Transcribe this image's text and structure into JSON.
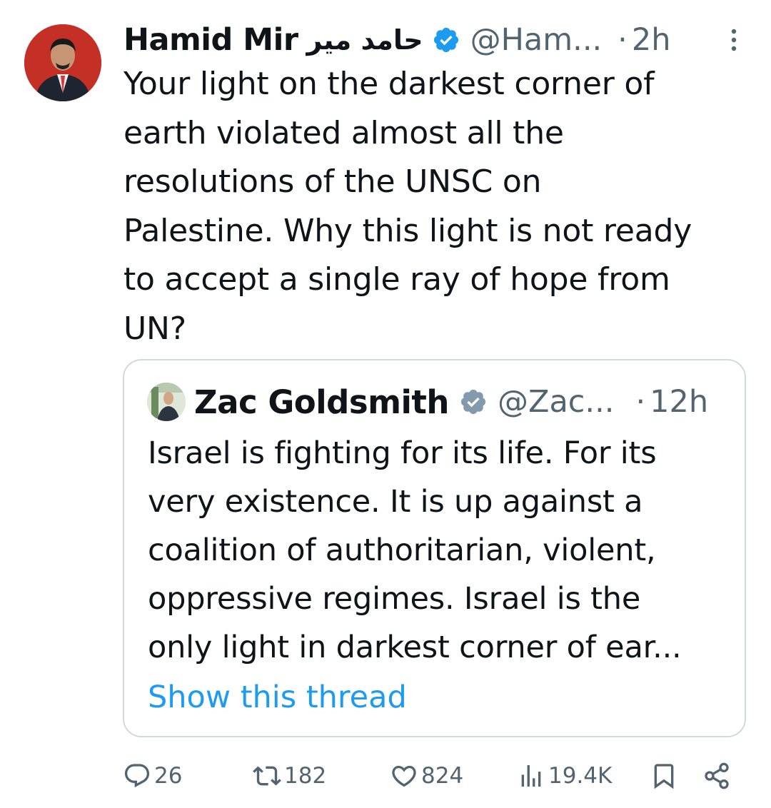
{
  "tweet": {
    "author_name": "Hamid Mir",
    "author_name_urdu": "حامد میر",
    "handle": "@Ham...",
    "separator": "·",
    "time": "2h",
    "text": "Your light on the darkest corner of\nearth violated almost all the\nresolutions of the UNSC on\nPalestine. Why this light is not ready\nto accept a single ray of hope from\nUN?"
  },
  "quoted": {
    "author_name": "Zac Goldsmith",
    "handle": "@Zac...",
    "separator": "·",
    "time": "12h",
    "text": "Israel is fighting for its life. For its\nvery existence. It is up against a\ncoalition of authoritarian, violent,\noppressive regimes. Israel is the\nonly light in darkest corner of ear...",
    "show_thread": "Show this thread"
  },
  "actions": {
    "replies": "26",
    "retweets": "182",
    "likes": "824",
    "views": "19.4K"
  },
  "colors": {
    "text": "#0f1419",
    "secondary": "#536471",
    "link": "#1d9bf0",
    "verified": "#1d9bf0",
    "quote_border": "#cfd9de"
  },
  "icons": [
    "verified-badge-icon",
    "more-icon",
    "reply-icon",
    "retweet-icon",
    "like-icon",
    "views-icon",
    "bookmark-icon",
    "share-icon"
  ]
}
